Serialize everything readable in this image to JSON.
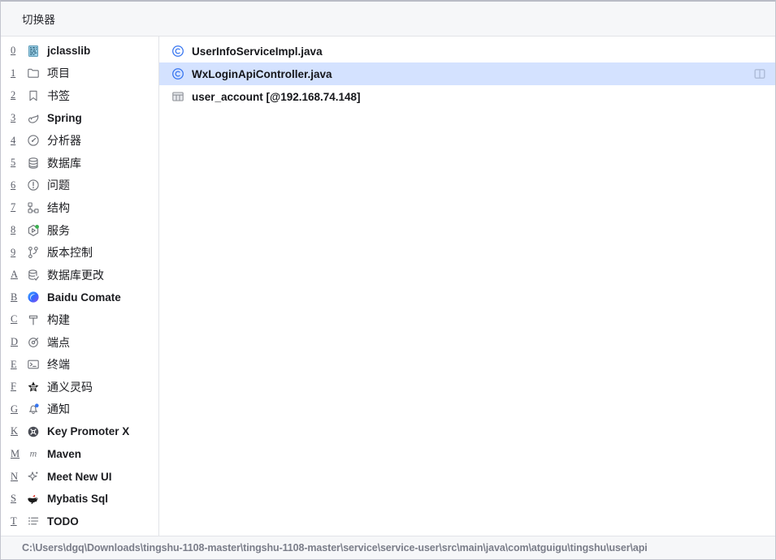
{
  "window": {
    "title": "切换器"
  },
  "toolwindows": {
    "items": [
      {
        "mnemonic": "0",
        "label": "jclasslib",
        "icon": "jclasslib-icon",
        "cjk": false
      },
      {
        "mnemonic": "1",
        "label": "项目",
        "icon": "folder-icon",
        "cjk": true
      },
      {
        "mnemonic": "2",
        "label": "书签",
        "icon": "bookmark-icon",
        "cjk": true
      },
      {
        "mnemonic": "3",
        "label": "Spring",
        "icon": "spring-leaf-icon",
        "cjk": false
      },
      {
        "mnemonic": "4",
        "label": "分析器",
        "icon": "profiler-gauge-icon",
        "cjk": true
      },
      {
        "mnemonic": "5",
        "label": "数据库",
        "icon": "database-icon",
        "cjk": true
      },
      {
        "mnemonic": "6",
        "label": "问题",
        "icon": "problems-warning-icon",
        "cjk": true
      },
      {
        "mnemonic": "7",
        "label": "结构",
        "icon": "structure-icon",
        "cjk": true
      },
      {
        "mnemonic": "8",
        "label": "服务",
        "icon": "services-run-icon",
        "cjk": true
      },
      {
        "mnemonic": "9",
        "label": "版本控制",
        "icon": "version-control-branch-icon",
        "cjk": true
      },
      {
        "mnemonic": "A",
        "label": "数据库更改",
        "icon": "database-changes-icon",
        "cjk": true
      },
      {
        "mnemonic": "B",
        "label": "Baidu Comate",
        "icon": "baidu-comate-icon",
        "cjk": false
      },
      {
        "mnemonic": "C",
        "label": "构建",
        "icon": "build-hammer-icon",
        "cjk": true
      },
      {
        "mnemonic": "D",
        "label": "端点",
        "icon": "endpoints-icon",
        "cjk": true
      },
      {
        "mnemonic": "E",
        "label": "终端",
        "icon": "terminal-icon",
        "cjk": true
      },
      {
        "mnemonic": "F",
        "label": "通义灵码",
        "icon": "tongyi-lingma-icon",
        "cjk": true
      },
      {
        "mnemonic": "G",
        "label": "通知",
        "icon": "notifications-bell-icon",
        "cjk": true
      },
      {
        "mnemonic": "K",
        "label": "Key Promoter X",
        "icon": "key-promoter-icon",
        "cjk": false
      },
      {
        "mnemonic": "M",
        "label": "Maven",
        "icon": "maven-icon",
        "cjk": false
      },
      {
        "mnemonic": "N",
        "label": "Meet New UI",
        "icon": "sparkle-icon",
        "cjk": false
      },
      {
        "mnemonic": "S",
        "label": "Mybatis Sql",
        "icon": "mybatis-bird-icon",
        "cjk": false
      },
      {
        "mnemonic": "T",
        "label": "TODO",
        "icon": "todo-list-icon",
        "cjk": false
      }
    ]
  },
  "files": {
    "items": [
      {
        "name": "UserInfoServiceImpl.java",
        "icon": "java-class-icon",
        "selected": false,
        "action": null
      },
      {
        "name": "WxLoginApiController.java",
        "icon": "java-class-icon",
        "selected": true,
        "action": "split-window-icon"
      },
      {
        "name": "user_account [@192.168.74.148]",
        "icon": "db-table-icon",
        "selected": false,
        "action": null
      }
    ]
  },
  "statusbar": {
    "path": "C:\\Users\\dgq\\Downloads\\tingshu-1108-master\\tingshu-1108-master\\service\\service-user\\src\\main\\java\\com\\atguigu\\tingshu\\user\\api"
  },
  "colors": {
    "selection": "#d4e2ff",
    "titlebar_bg": "#f6f7f9",
    "statusbar_bg": "#f6f7f9",
    "icon_gray": "#6e7178",
    "java_blue": "#3574f0",
    "accent_green": "#3bb050"
  }
}
